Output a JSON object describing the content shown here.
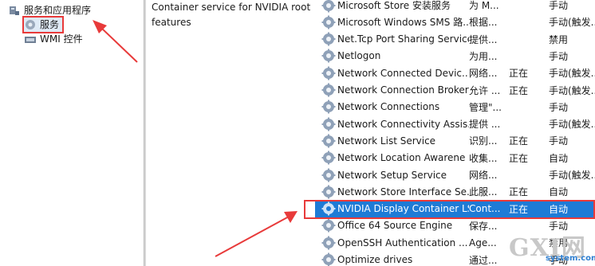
{
  "tree": {
    "apps_label": "服务和应用程序",
    "services_label": "服务",
    "wmi_label": "WMI 控件"
  },
  "description": {
    "line1": "Container service for NVIDIA root",
    "line2": "features"
  },
  "services": [
    {
      "name": "Microsoft Store 安装服务",
      "desc": "为 M...",
      "status": "",
      "startup": "手动"
    },
    {
      "name": "Microsoft Windows SMS 路...",
      "desc": "根据...",
      "status": "",
      "startup": "手动(触发..."
    },
    {
      "name": "Net.Tcp Port Sharing Service",
      "desc": "提供...",
      "status": "",
      "startup": "禁用"
    },
    {
      "name": "Netlogon",
      "desc": "为用...",
      "status": "",
      "startup": "手动"
    },
    {
      "name": "Network Connected Devic...",
      "desc": "网络...",
      "status": "正在",
      "startup": "手动(触发..."
    },
    {
      "name": "Network Connection Broker",
      "desc": "允许 ...",
      "status": "正在",
      "startup": "手动(触发..."
    },
    {
      "name": "Network Connections",
      "desc": "管理\"...",
      "status": "",
      "startup": "手动"
    },
    {
      "name": "Network Connectivity Assis...",
      "desc": "提供 ...",
      "status": "",
      "startup": "手动(触发..."
    },
    {
      "name": "Network List Service",
      "desc": "识别...",
      "status": "正在",
      "startup": "手动"
    },
    {
      "name": "Network Location Awarene",
      "desc": "收集...",
      "status": "正在",
      "startup": "自动"
    },
    {
      "name": "Network Setup Service",
      "desc": "网络...",
      "status": "",
      "startup": "手动(触发..."
    },
    {
      "name": "Network Store Interface Se...",
      "desc": "此服...",
      "status": "正在",
      "startup": "自动"
    },
    {
      "name": "NVIDIA Display Container LS",
      "desc": "Cont...",
      "status": "正在",
      "startup": "自动",
      "selected": true
    },
    {
      "name": "Office 64 Source Engine",
      "desc": "保存...",
      "status": "",
      "startup": "手动"
    },
    {
      "name": "OpenSSH Authentication ...",
      "desc": "Age...",
      "status": "",
      "startup": "禁用"
    },
    {
      "name": "Optimize drives",
      "desc": "通过...",
      "status": "",
      "startup": "手动"
    }
  ],
  "colors": {
    "selection": "#1e7bd6",
    "annotation": "#e83a3a"
  },
  "icons": {
    "tree_apps": "services-apps-icon",
    "tree_services": "gear-icon",
    "tree_wmi": "wmi-icon",
    "service": "gear-icon"
  },
  "watermark": {
    "main": "GXI网",
    "sub": "system.com"
  }
}
